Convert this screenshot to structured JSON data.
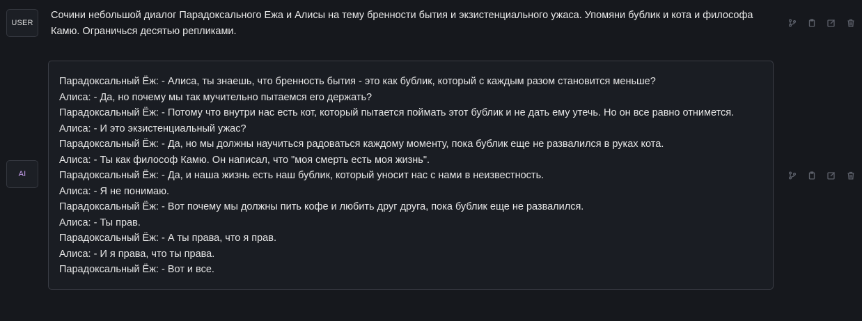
{
  "user_message": {
    "avatar_label": "USER",
    "text": "Сочини небольшой диалог Парадоксального Ежа и Алисы на тему бренности бытия и экзистенциального ужаса. Упомяни бублик и кота и философа Камю. Ограничься десятью репликами."
  },
  "ai_message": {
    "avatar_label": "AI",
    "lines": [
      "Парадоксальный Ёж: - Алиса, ты знаешь, что бренность бытия - это как бублик, который с каждым разом становится меньше?",
      "Алиса: - Да, но почему мы так мучительно пытаемся его держать?",
      "Парадоксальный Ёж: - Потому что внутри нас есть кот, который пытается поймать этот бублик и не дать ему утечь. Но он все равно отнимется.",
      "Алиса: - И это экзистенциальный ужас?",
      "Парадоксальный Ёж: - Да, но мы должны научиться радоваться каждому моменту, пока бублик еще не развалился в руках кота.",
      "Алиса: - Ты как философ Камю. Он написал, что \"моя смерть есть моя жизнь\".",
      "Парадоксальный Ёж: - Да, и наша жизнь есть наш бублик, который уносит нас с нами в неизвестность.",
      "Алиса: - Я не понимаю.",
      "Парадоксальный Ёж: - Вот почему мы должны пить кофе и любить друг друга, пока бублик еще не развалился.",
      "Алиса: - Ты прав.",
      "Парадоксальный Ёж: - А ты права, что я прав.",
      "Алиса: - И я права, что ты права.",
      "Парадоксальный Ёж: - Вот и все."
    ]
  },
  "actions": {
    "icons": [
      "branch-icon",
      "copy-icon",
      "edit-icon",
      "delete-icon"
    ],
    "icon_color": "#5c606a"
  },
  "colors": {
    "background": "#16181d",
    "ai_avatar_text": "#c9a0f0"
  }
}
